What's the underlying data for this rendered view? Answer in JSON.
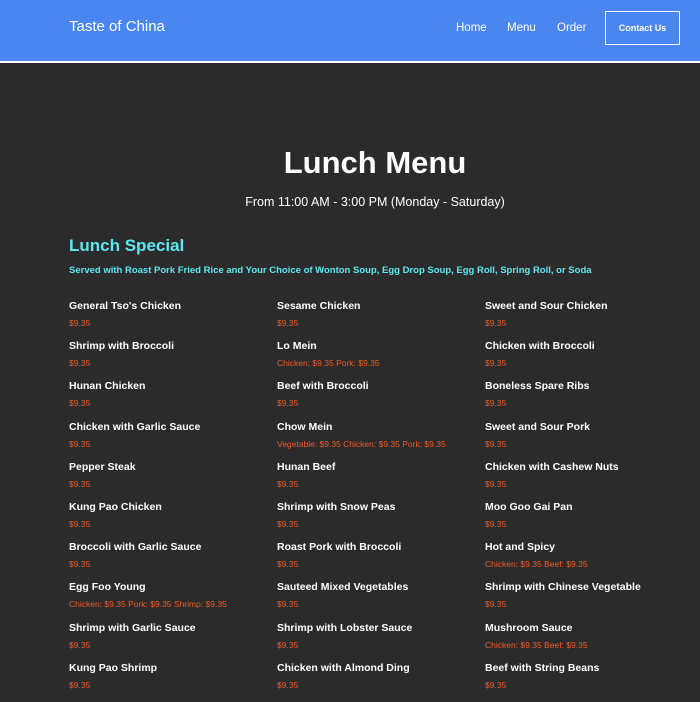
{
  "header": {
    "brand": "Taste of China",
    "nav": [
      "Home",
      "Menu",
      "Order"
    ],
    "contact_label": "Contact Us"
  },
  "page": {
    "title": "Lunch Menu",
    "hours": "From 11:00 AM - 3:00 PM (Monday - Saturday)"
  },
  "section": {
    "title": "Lunch Special",
    "subtitle": "Served with Roast Pork Fried Rice and Your Choice of Wonton Soup, Egg Drop Soup, Egg Roll, Spring Roll, or Soda"
  },
  "colors": {
    "header_bg": "#4a86f0",
    "page_bg": "#2b2b2b",
    "accent_cyan": "#5ee8f2",
    "price_orange": "#f05a28"
  },
  "columns": [
    [
      {
        "name": "General Tso's Chicken",
        "price": "$9.35"
      },
      {
        "name": "Shrimp with Broccoli",
        "price": "$9.35"
      },
      {
        "name": "Hunan Chicken",
        "price": "$9.35"
      },
      {
        "name": "Chicken with Garlic Sauce",
        "price": "$9.35"
      },
      {
        "name": "Pepper Steak",
        "price": "$9.35"
      },
      {
        "name": "Kung Pao Chicken",
        "price": "$9.35"
      },
      {
        "name": "Broccoli with Garlic Sauce",
        "price": "$9.35"
      },
      {
        "name": "Egg Foo Young",
        "price": "Chicken: $9.35 Pork: $9.35 Shrimp: $9.35"
      },
      {
        "name": "Shrimp with Garlic Sauce",
        "price": "$9.35"
      },
      {
        "name": "Kung Pao Shrimp",
        "price": "$9.35"
      }
    ],
    [
      {
        "name": "Sesame Chicken",
        "price": "$9.35"
      },
      {
        "name": "Lo Mein",
        "price": "Chicken: $9.35 Pork: $9.35"
      },
      {
        "name": "Beef with Broccoli",
        "price": "$9.35"
      },
      {
        "name": "Chow Mein",
        "price": "Vegetable: $9.35 Chicken: $9.35 Pork: $9.35"
      },
      {
        "name": "Hunan Beef",
        "price": "$9.35"
      },
      {
        "name": "Shrimp with Snow Peas",
        "price": "$9.35"
      },
      {
        "name": "Roast Pork with Broccoli",
        "price": "$9.35"
      },
      {
        "name": "Sauteed Mixed Vegetables",
        "price": "$9.35"
      },
      {
        "name": "Shrimp with Lobster Sauce",
        "price": "$9.35"
      },
      {
        "name": "Chicken with Almond Ding",
        "price": "$9.35"
      }
    ],
    [
      {
        "name": "Sweet and Sour Chicken",
        "price": "$9.35"
      },
      {
        "name": "Chicken with Broccoli",
        "price": "$9.35"
      },
      {
        "name": "Boneless Spare Ribs",
        "price": "$9.35"
      },
      {
        "name": "Sweet and Sour Pork",
        "price": "$9.35"
      },
      {
        "name": "Chicken with Cashew Nuts",
        "price": "$9.35"
      },
      {
        "name": "Moo Goo Gai Pan",
        "price": "$9.35"
      },
      {
        "name": "Hot and Spicy",
        "price": "Chicken: $9.35 Beef: $9.35"
      },
      {
        "name": "Shrimp with Chinese Vegetable",
        "price": "$9.35"
      },
      {
        "name": "Mushroom Sauce",
        "price": "Chicken: $9.35 Beef: $9.35"
      },
      {
        "name": "Beef with String Beans",
        "price": "$9.35"
      }
    ]
  ]
}
